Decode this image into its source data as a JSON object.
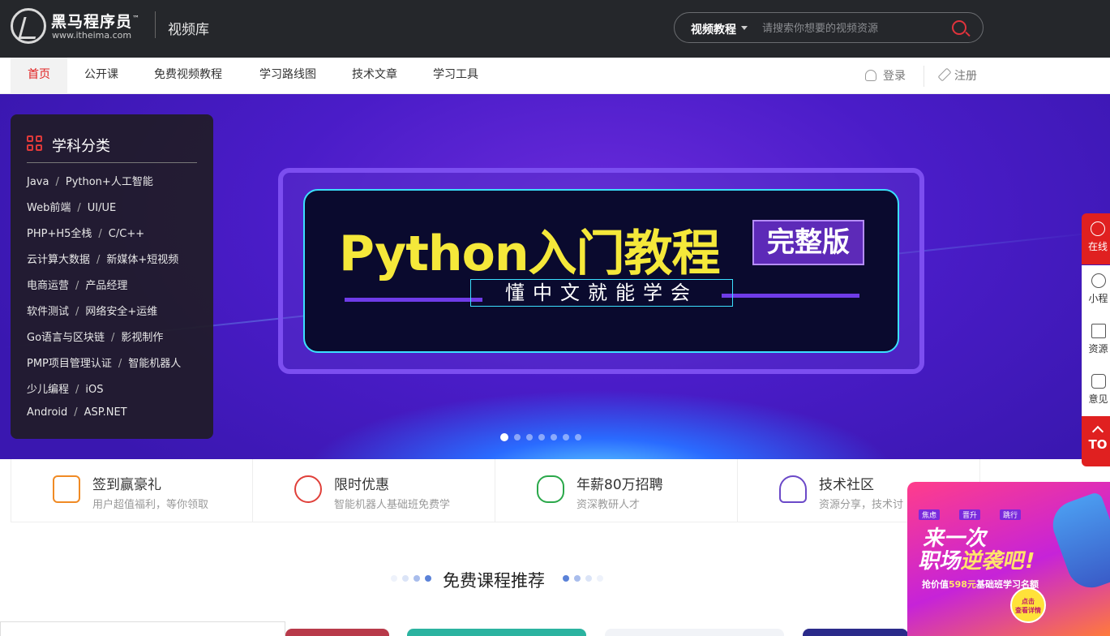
{
  "header": {
    "brand": "黑马程序员",
    "brand_tm": "™",
    "url": "www.itheima.com",
    "site_name": "视频库",
    "search": {
      "category": "视频教程",
      "placeholder": "请搜索你想要的视频资源"
    }
  },
  "nav": {
    "items": [
      {
        "label": "首页",
        "active": true
      },
      {
        "label": "公开课"
      },
      {
        "label": "免费视频教程"
      },
      {
        "label": "学习路线图"
      },
      {
        "label": "技术文章"
      },
      {
        "label": "学习工具"
      }
    ],
    "login": "登录",
    "register": "注册"
  },
  "banner": {
    "title": "Python入门教程",
    "badge": "完整版",
    "subtitle": "懂中文就能学会",
    "slide_count": 7,
    "active_slide": 0
  },
  "categories": {
    "title": "学科分类",
    "rows": [
      [
        "Java",
        "Python+人工智能"
      ],
      [
        "Web前端",
        "UI/UE"
      ],
      [
        "PHP+H5全栈",
        "C/C++"
      ],
      [
        "云计算大数据",
        "新媒体+短视频"
      ],
      [
        "电商运营",
        "产品经理"
      ],
      [
        "软件测试",
        "网络安全+运维"
      ],
      [
        "Go语言与区块链",
        "影视制作"
      ],
      [
        "PMP项目管理认证",
        "智能机器人"
      ],
      [
        "少儿编程",
        "iOS"
      ],
      [
        "Android",
        "ASP.NET"
      ]
    ]
  },
  "promos": [
    {
      "title": "签到赢豪礼",
      "desc": "用户超值福利，等你领取",
      "icon": "calendar-icon",
      "color": "#f08a24"
    },
    {
      "title": "限时优惠",
      "desc": "智能机器人基础班免费学",
      "icon": "discount-icon",
      "color": "#e0403a"
    },
    {
      "title": "年薪80万招聘",
      "desc": "资深教研人才",
      "icon": "money-icon",
      "color": "#2aa84a"
    },
    {
      "title": "技术社区",
      "desc": "资源分享，技术讨",
      "icon": "community-icon",
      "color": "#6b49c8"
    }
  ],
  "section": {
    "title": "免费课程推荐"
  },
  "right_toolbar": [
    {
      "label": "在线",
      "icon": "headset-icon",
      "style": "red"
    },
    {
      "label": "小程",
      "icon": "miniprogram-icon",
      "style": "white"
    },
    {
      "label": "资源",
      "icon": "resource-icon",
      "style": "white"
    },
    {
      "label": "意见",
      "icon": "feedback-icon",
      "style": "white"
    },
    {
      "label": "TO",
      "icon": "arrow-up-icon",
      "style": "red"
    }
  ],
  "ad": {
    "tags": [
      "焦虑",
      "晋升",
      "跳行"
    ],
    "headline_1": "来一次",
    "headline_2a": "职场",
    "headline_2b": "逆袭吧!",
    "offer_prefix": "抢价值",
    "offer_price": "598元",
    "offer_suffix": "基础班学习名额",
    "cta_1": "点击",
    "cta_2": "查看详情"
  },
  "colors": {
    "header_bg": "#25272b",
    "accent": "#e02020",
    "banner_title": "#f5e83a"
  }
}
